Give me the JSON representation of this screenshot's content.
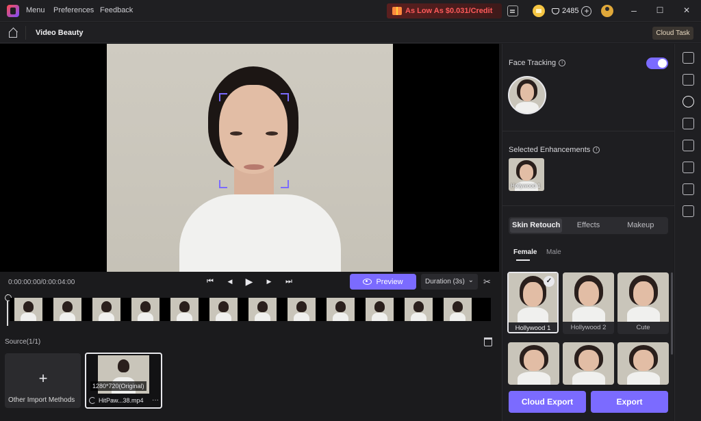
{
  "titlebar": {
    "menus": [
      "Menu",
      "Preferences",
      "Feedback"
    ],
    "promo": "As Low As $0.031/Credit",
    "credits": "2485",
    "window_controls": {
      "minimize": "–",
      "maximize": "☐",
      "close": "✕"
    }
  },
  "subbar": {
    "title": "Video Beauty",
    "cloud_task": "Cloud Task"
  },
  "playback": {
    "timecode": "0:00:00:00/0:00:04:00",
    "controls": {
      "prev": "⏮",
      "step_back": "◀",
      "play": "▶",
      "step_forward": "▶",
      "next": "⏭"
    },
    "preview_label": "Preview",
    "duration_label": "Duration (3s)",
    "dropdown_arrow": "⌄",
    "scissors": "✂"
  },
  "source": {
    "label": "Source(1/1)",
    "import_label": "Other Import Methods",
    "import_plus": "+",
    "clip": {
      "resolution": "1280*720(Original)",
      "name": "HitPaw...38.mp4",
      "more": "···"
    }
  },
  "panel": {
    "face_tracking_label": "Face Tracking",
    "face_tracking_on": true,
    "info_glyph": "i",
    "selected_label": "Selected Enhancements",
    "selected_item": "Hollywood 1",
    "tabs": [
      {
        "label": "Skin Retouch",
        "active": true
      },
      {
        "label": "Effects",
        "active": false
      },
      {
        "label": "Makeup",
        "active": false
      }
    ],
    "subtabs": [
      {
        "label": "Female",
        "active": true
      },
      {
        "label": "Male",
        "active": false
      }
    ],
    "presets": [
      {
        "label": "Hollywood 1",
        "selected": true
      },
      {
        "label": "Hollywood 2",
        "selected": false
      },
      {
        "label": "Cute",
        "selected": false
      },
      {
        "label": "",
        "selected": false
      },
      {
        "label": "",
        "selected": false
      },
      {
        "label": "",
        "selected": false
      }
    ],
    "check": "✓",
    "cloud_export": "Cloud Export",
    "export": "Export"
  },
  "rail": {
    "icons": [
      "video-enhance-icon",
      "curve-icon",
      "face-swap-icon",
      "add-module-icon",
      "edit-icon",
      "eraser-icon",
      "ai-select-icon",
      "video-plus-icon"
    ]
  },
  "colors": {
    "accent": "#7b6bff",
    "promo_text": "#ff5a5a",
    "background": "#1b1b1d"
  }
}
